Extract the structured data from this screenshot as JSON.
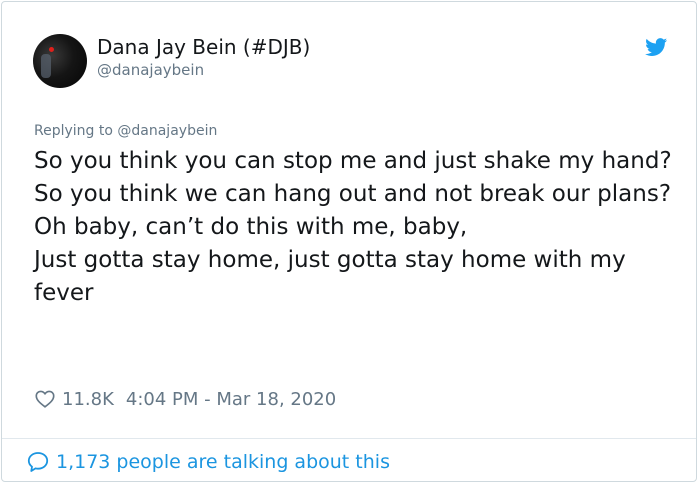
{
  "author": {
    "display_name": "Dana Jay Bein (#DJB)",
    "handle": "@danajaybein"
  },
  "reply": {
    "prefix": "Replying to ",
    "mention": "@danajaybein"
  },
  "tweet": {
    "lines": [
      "So you think you can stop me and just shake my hand?",
      "So you think we can hang out and not break our plans?",
      "Oh baby, can’t do this with me, baby,",
      "Just gotta stay home, just gotta stay home with my fever"
    ]
  },
  "meta": {
    "like_count": "11.8K",
    "timestamp": "4:04 PM - Mar 18, 2020"
  },
  "footer": {
    "talking_text": "1,173 people are talking about this"
  },
  "icons": {
    "brand": "twitter-bird-icon",
    "like": "heart-icon",
    "conversation": "speech-bubble-icon"
  },
  "colors": {
    "brand_blue": "#1da1f2",
    "link_blue": "#1b95e0",
    "secondary_text": "#657786",
    "primary_text": "#14171a"
  }
}
